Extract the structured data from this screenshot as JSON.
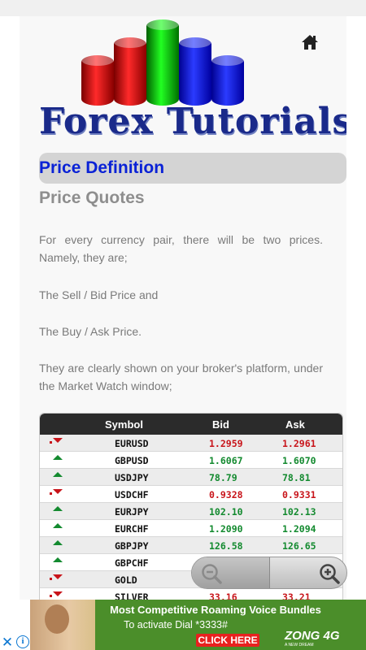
{
  "header": {
    "logo_text": "Forex Tutorials",
    "home_icon": "home-icon"
  },
  "section": {
    "title": "Price Definition",
    "subtitle": "Price Quotes"
  },
  "paragraphs": [
    "For every currency pair, there will be two prices. Namely, they are;",
    "The Sell / Bid Price and",
    "The Buy / Ask Price.",
    "They are clearly shown on your broker's platform, under the Market Watch window;"
  ],
  "market_watch": {
    "columns": [
      "Symbol",
      "Bid",
      "Ask"
    ],
    "rows": [
      {
        "dir": "down",
        "symbol": "EURUSD",
        "bid": "1.2959",
        "ask": "1.2961"
      },
      {
        "dir": "up",
        "symbol": "GBPUSD",
        "bid": "1.6067",
        "ask": "1.6070"
      },
      {
        "dir": "up",
        "symbol": "USDJPY",
        "bid": "78.79",
        "ask": "78.81"
      },
      {
        "dir": "down",
        "symbol": "USDCHF",
        "bid": "0.9328",
        "ask": "0.9331"
      },
      {
        "dir": "up",
        "symbol": "EURJPY",
        "bid": "102.10",
        "ask": "102.13"
      },
      {
        "dir": "up",
        "symbol": "EURCHF",
        "bid": "1.2090",
        "ask": "1.2094"
      },
      {
        "dir": "up",
        "symbol": "GBPJPY",
        "bid": "126.58",
        "ask": "126.65"
      },
      {
        "dir": "up",
        "symbol": "GBPCHF",
        "bid": "",
        "ask": ""
      },
      {
        "dir": "down",
        "symbol": "GOLD",
        "bid": "",
        "ask": ""
      },
      {
        "dir": "down",
        "symbol": "SILVER",
        "bid": "33.16",
        "ask": "33.21"
      }
    ],
    "colors": {
      "up": "#138a2f",
      "down": "#c8141a"
    }
  },
  "zoom_controls": {
    "zoom_out_icon": "zoom-out-icon",
    "zoom_in_icon": "zoom-in-icon"
  },
  "ad": {
    "line1": "Most Competitive Roaming Voice Bundles",
    "line2": "To activate Dial *3333#",
    "cta": "CLICK HERE",
    "brand": "ZONG 4G",
    "brand_sub": "A NEW DREAM",
    "close_icon": "close-icon",
    "info_icon": "info-icon"
  }
}
